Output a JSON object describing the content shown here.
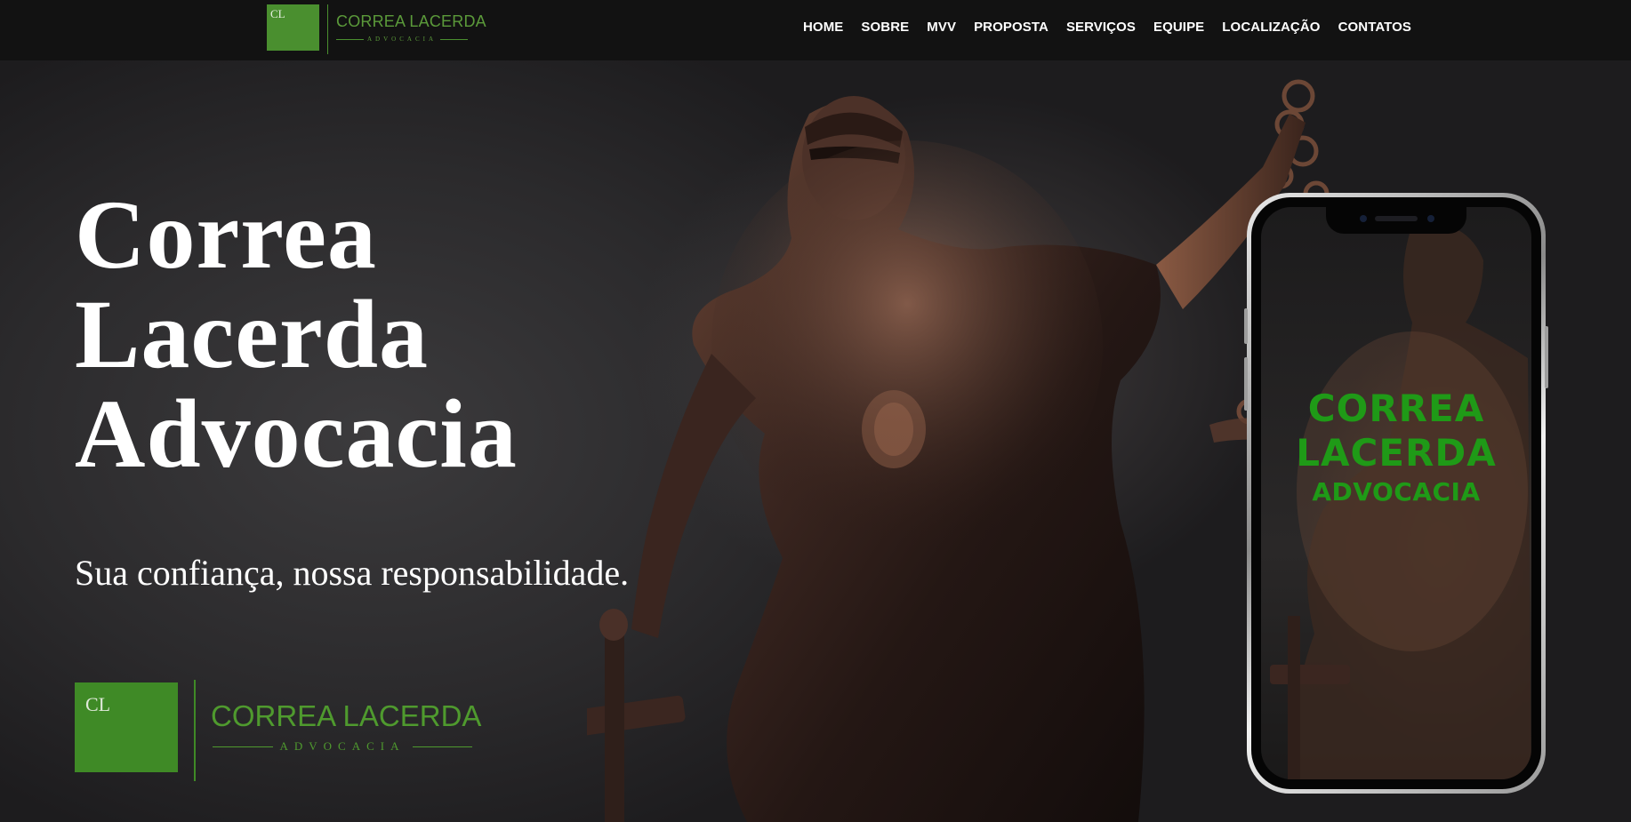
{
  "nav": {
    "logo": {
      "initials": "CL",
      "name": "CORREA LACERDA",
      "subtitle": "ADVOCACIA"
    },
    "items": [
      {
        "label": "HOME"
      },
      {
        "label": "SOBRE"
      },
      {
        "label": "MVV"
      },
      {
        "label": "PROPOSTA"
      },
      {
        "label": "SERVIÇOS"
      },
      {
        "label": "EQUIPE"
      },
      {
        "label": "LOCALIZAÇÃO"
      },
      {
        "label": "CONTATOS"
      }
    ]
  },
  "hero": {
    "title_lines": [
      "Correa",
      "Lacerda",
      "Advocacia"
    ],
    "tagline": "Sua confiança, nossa responsabilidade.",
    "logo": {
      "initials": "CL",
      "name": "CORREA LACERDA",
      "subtitle": "ADVOCACIA"
    },
    "phone": {
      "line1": "CORREA",
      "line2": "LACERDA",
      "line3": "ADVOCACIA"
    }
  },
  "colors": {
    "brand_green": "#4a8f2f",
    "phone_text_green": "#1f9a17",
    "nav_background": "#121212"
  }
}
